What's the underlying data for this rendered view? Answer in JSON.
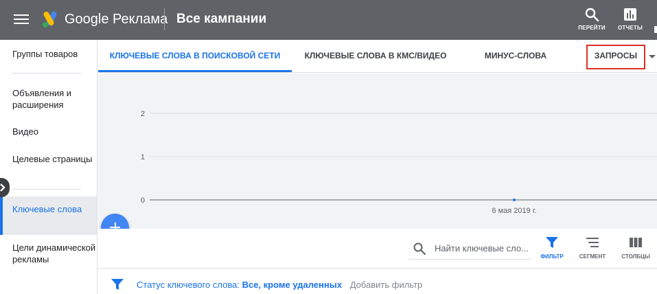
{
  "header": {
    "brand": "Google Реклама",
    "page_title": "Все кампании",
    "actions": [
      {
        "label": "ПЕРЕЙТИ",
        "icon": "search-icon"
      },
      {
        "label": "ОТЧЕТЫ",
        "icon": "reports-icon"
      }
    ]
  },
  "sidebar": {
    "items": [
      {
        "label": "Группы товаров"
      },
      {
        "label": "Объявления и расширения"
      },
      {
        "label": "Видео"
      },
      {
        "label": "Целевые страницы"
      },
      {
        "label": "Ключевые слова",
        "active": true
      },
      {
        "label": "Цели динамической рекламы"
      }
    ]
  },
  "tabs": [
    {
      "label": "КЛЮЧЕВЫЕ СЛОВА В ПОИСКОВОЙ СЕТИ",
      "active": true
    },
    {
      "label": "КЛЮЧЕВЫЕ СЛОВА В КМС/ВИДЕО"
    },
    {
      "label": "МИНУС-СЛОВА"
    },
    {
      "label": "ЗАПРОСЫ",
      "highlighted": true
    }
  ],
  "chart_data": {
    "type": "line",
    "x": [
      "6 мая 2019 г."
    ],
    "series": [
      {
        "values": [
          0
        ]
      }
    ],
    "yticks": [
      "2",
      "1",
      "0"
    ],
    "ylim": [
      0,
      2
    ],
    "grid": true
  },
  "toolbar": {
    "search_placeholder": "Найти ключевые сло...",
    "buttons": [
      {
        "label": "ФИЛЬТР",
        "active": true
      },
      {
        "label": "СЕГМЕНТ"
      },
      {
        "label": "СТОЛБЦЫ"
      }
    ]
  },
  "filter": {
    "label": "Статус ключевого слова:",
    "value": "Все, кроме удаленных",
    "add_filter": "Добавить фильтр"
  },
  "colors": {
    "accent": "#1a73e8",
    "header_bg": "#5f6368",
    "highlight_border": "#d93025",
    "fab": "#4285f4"
  }
}
